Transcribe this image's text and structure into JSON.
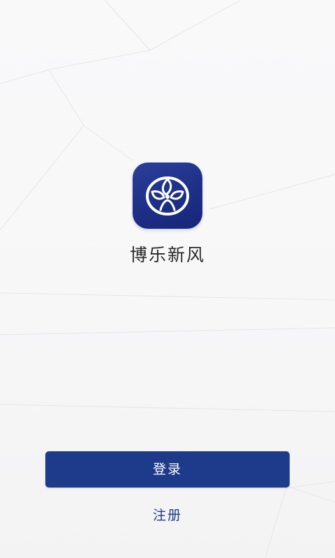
{
  "app": {
    "name": "博乐新风",
    "icon": "fan-logo-icon",
    "brand_color": "#1e3a8a"
  },
  "actions": {
    "login_label": "登录",
    "register_label": "注册"
  },
  "colors": {
    "background": "#f7f7f8",
    "button_bg": "#1e3a8a",
    "button_text": "#ffffff",
    "link_text": "#1e3a8a"
  }
}
